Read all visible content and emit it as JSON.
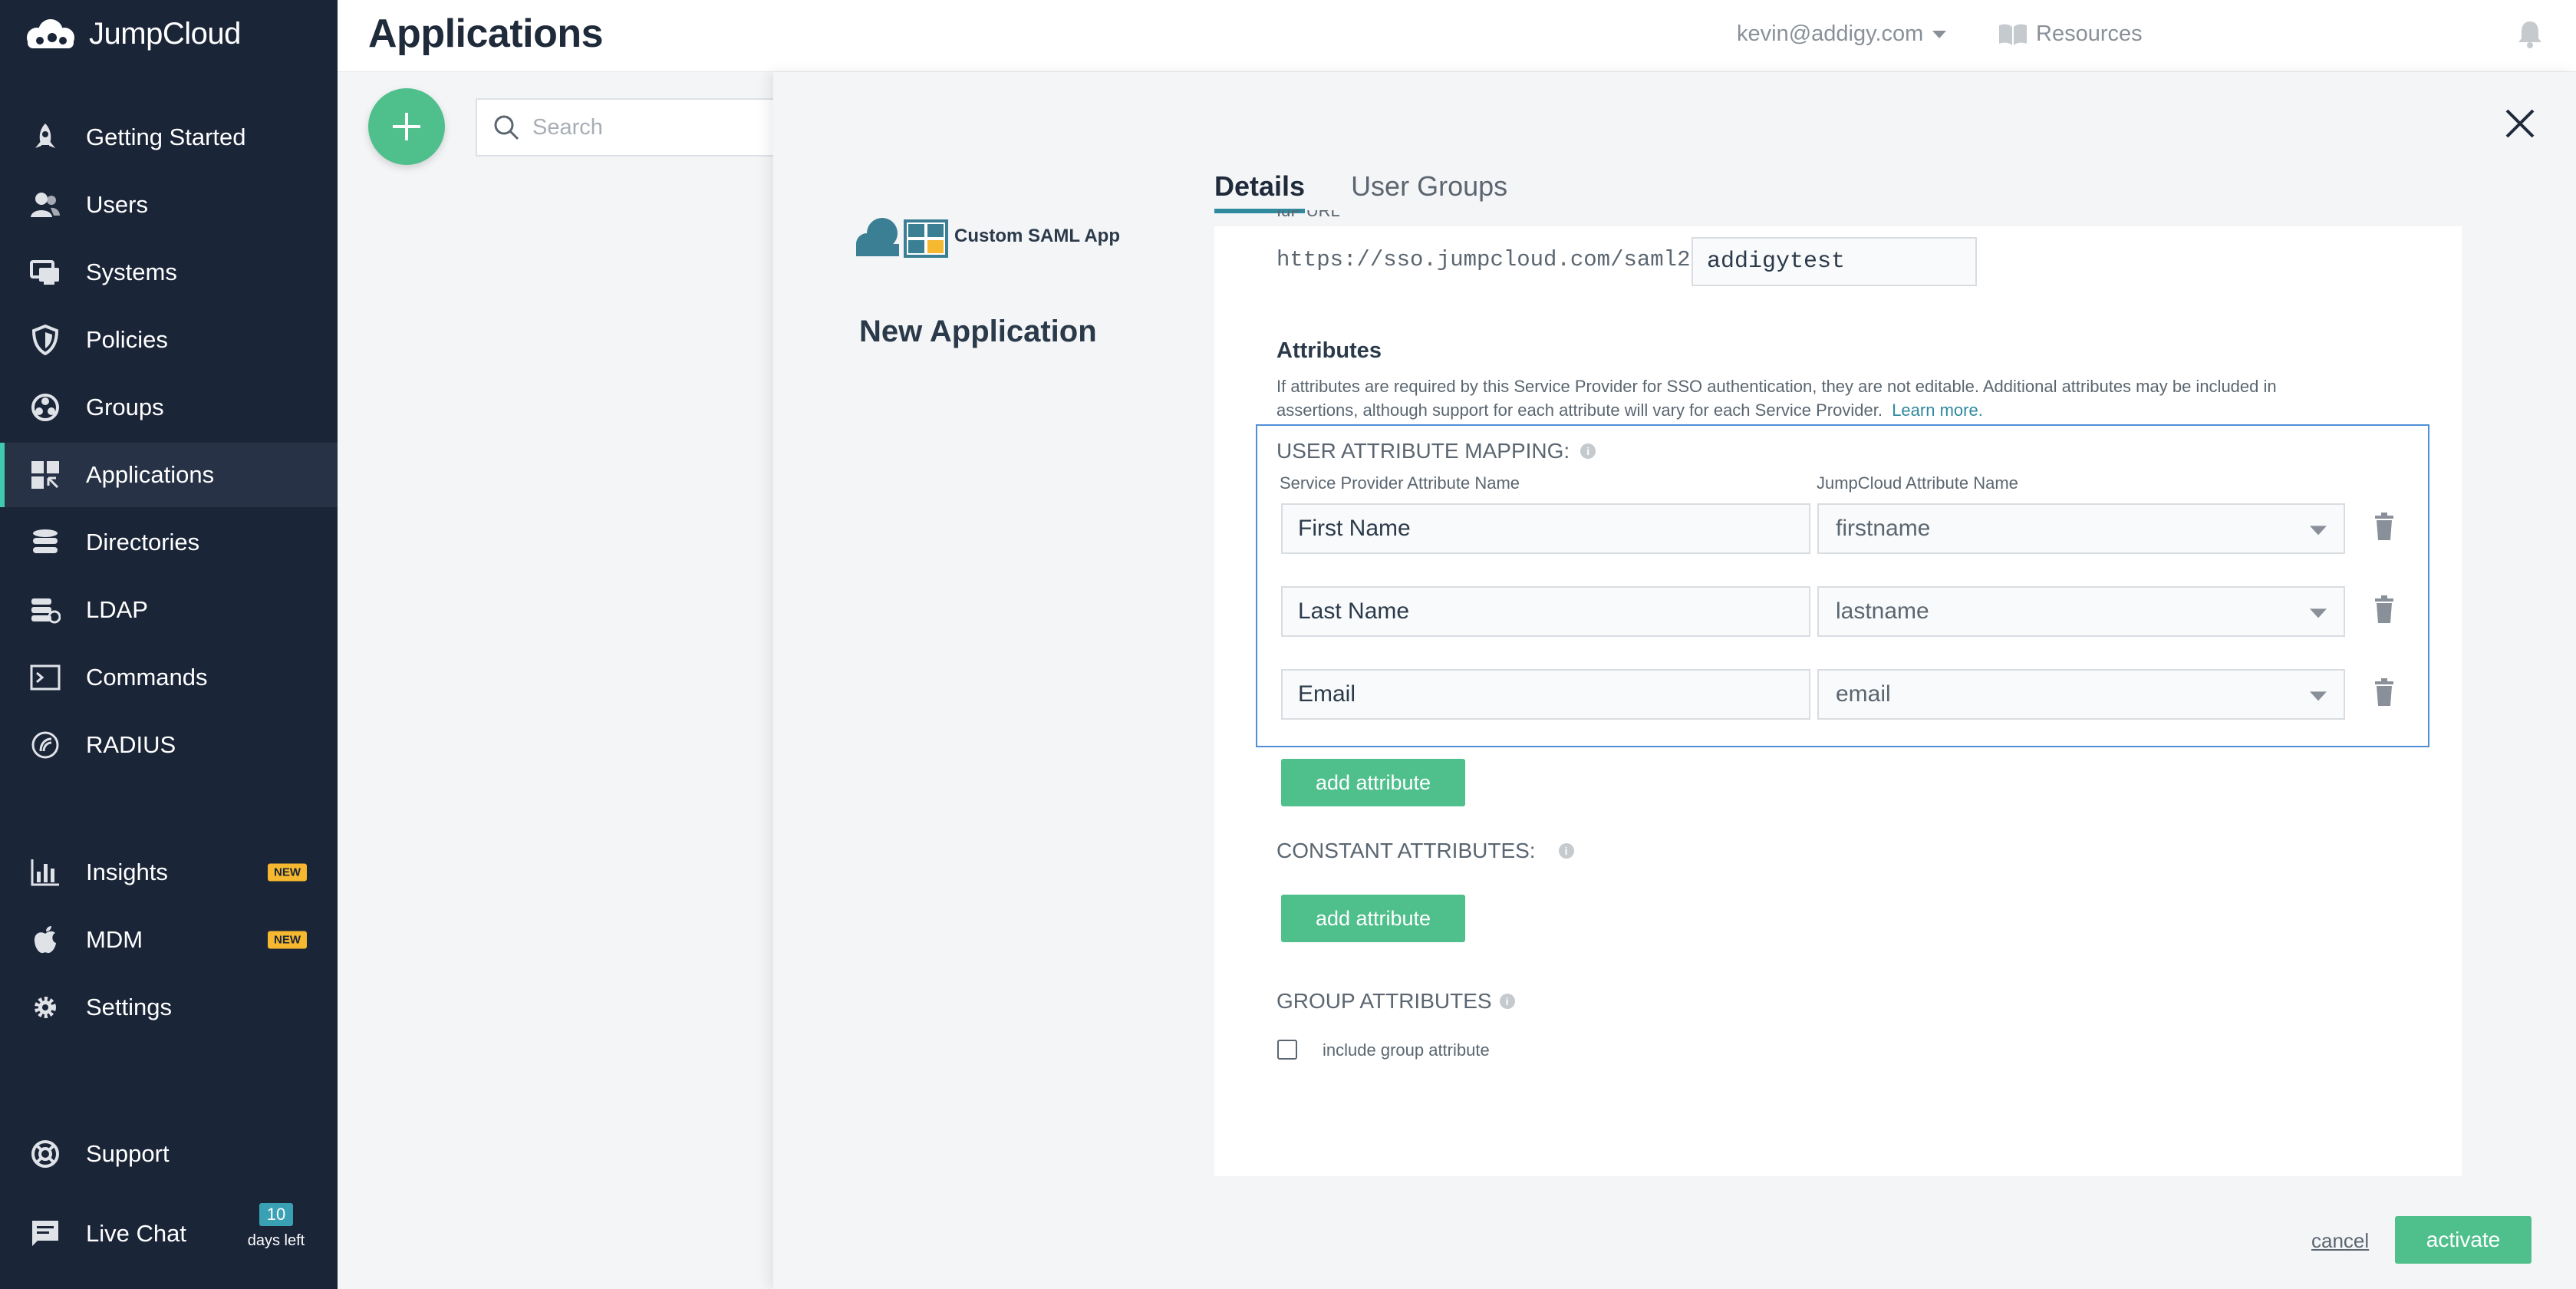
{
  "app": {
    "brand": "JumpCloud"
  },
  "sidebar": {
    "items": [
      {
        "label": "Getting Started",
        "icon": "rocket-icon"
      },
      {
        "label": "Users",
        "icon": "users-icon"
      },
      {
        "label": "Systems",
        "icon": "systems-icon"
      },
      {
        "label": "Policies",
        "icon": "shield-icon"
      },
      {
        "label": "Groups",
        "icon": "groups-icon"
      },
      {
        "label": "Applications",
        "icon": "applications-icon",
        "active": true
      },
      {
        "label": "Directories",
        "icon": "directories-icon"
      },
      {
        "label": "LDAP",
        "icon": "ldap-icon"
      },
      {
        "label": "Commands",
        "icon": "terminal-icon"
      },
      {
        "label": "RADIUS",
        "icon": "radius-icon"
      },
      {
        "label": "Insights",
        "icon": "bar-chart-icon",
        "badge": "NEW"
      },
      {
        "label": "MDM",
        "icon": "apple-icon",
        "badge": "NEW"
      },
      {
        "label": "Settings",
        "icon": "gear-icon"
      },
      {
        "label": "Support",
        "icon": "lifebuoy-icon"
      },
      {
        "label": "Live Chat",
        "icon": "chat-icon"
      }
    ],
    "trial": {
      "days": "10",
      "label": "days left"
    }
  },
  "header": {
    "title": "Applications",
    "user": "kevin@addigy.com",
    "resources": "Resources"
  },
  "toolbar": {
    "search_placeholder": "Search"
  },
  "panel": {
    "app_name": "Custom SAML App",
    "heading": "New Application",
    "tabs": [
      {
        "label": "Details",
        "active": true
      },
      {
        "label": "User Groups"
      }
    ],
    "idp_url_label": "IdP URL",
    "idp_url_prefix": "https://sso.jumpcloud.com/saml2/",
    "idp_url_value": "addigytest",
    "attributes_title": "Attributes",
    "attributes_desc": "If attributes are required by this Service Provider for SSO authentication, they are not editable. Additional attributes may be included in assertions, although support for each attribute will vary for each Service Provider.",
    "learn_more": "Learn more.",
    "mapping_title": "USER ATTRIBUTE MAPPING:",
    "col_sp": "Service Provider Attribute Name",
    "col_jc": "JumpCloud Attribute Name",
    "rows": [
      {
        "sp": "First Name",
        "jc": "firstname"
      },
      {
        "sp": "Last Name",
        "jc": "lastname"
      },
      {
        "sp": "Email",
        "jc": "email"
      }
    ],
    "add_attribute": "add attribute",
    "constant_title": "CONSTANT ATTRIBUTES:",
    "group_title": "GROUP ATTRIBUTES",
    "include_group": "include group attribute",
    "cancel": "cancel",
    "activate": "activate"
  },
  "colors": {
    "sidebar_bg": "#1b2538",
    "accent_green": "#4fbf8c",
    "accent_teal": "#2f8a9e",
    "badge_yellow": "#f5b82e"
  }
}
